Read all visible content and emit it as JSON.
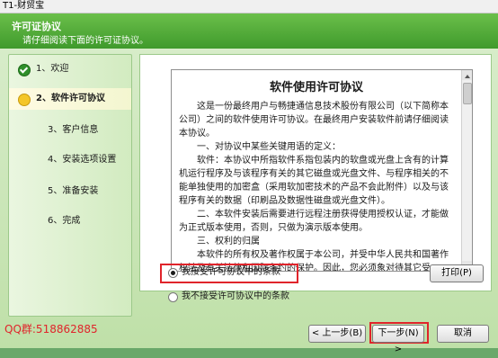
{
  "window": {
    "title": "T1-财贸宝"
  },
  "header": {
    "title": "许可证协议",
    "subtitle": "请仔细阅读下面的许可证协议。"
  },
  "steps": [
    {
      "label": "1、欢迎",
      "state": "done"
    },
    {
      "label": "2、软件许可协议",
      "state": "active"
    },
    {
      "label": "3、客户信息",
      "state": "pending"
    },
    {
      "label": "4、安装选项设置",
      "state": "pending"
    },
    {
      "label": "5、准备安装",
      "state": "pending"
    },
    {
      "label": "6、完成",
      "state": "pending"
    }
  ],
  "license": {
    "title": "软件使用许可协议",
    "paragraphs": [
      "这是一份最终用户与畅捷通信息技术股份有限公司（以下简称本公司）之间的软件使用许可协议。在最终用户安装软件前请仔细阅读本协议。",
      "一、对协议中某些关键用语的定义：",
      "软件：本协议中所指软件系指包装内的软盘或光盘上含有的计算机运行程序及与该程序有关的其它磁盘或光盘文件、与程序相关的不能单独使用的加密盒（采用软加密技术的产品不会此附件）以及与该程序有关的数据（印刷品及数据性磁盘或光盘文件）。",
      "二、本软件安装后需要进行远程注册获得使用授权认证，才能做为正式版本使用，否则，只做为演示版本使用。",
      "三、权利的归属",
      "本软件的所有权及著作权属于本公司，并受中华人民共和国著作权法及有关法律和国际条约的保护。因此，您必须象对待其它受"
    ]
  },
  "options": {
    "accept": "我接受许可协议中的条款",
    "decline": "我不接受许可协议中的条款",
    "selected": "accept"
  },
  "buttons": {
    "print": "打印(P)",
    "back": "< 上一步(B)",
    "next": "下一步(N) >",
    "cancel": "取消"
  },
  "watermark": "QQ群:518862885",
  "colors": {
    "highlight": "#e0242b",
    "header": "#3f9a2c"
  }
}
